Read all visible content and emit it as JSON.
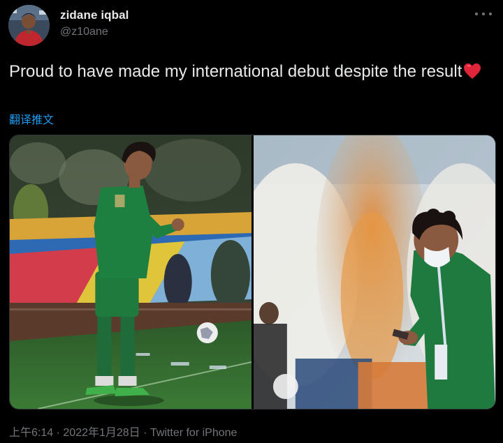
{
  "user": {
    "display_name": "zidane iqbal",
    "handle": "@z10ane"
  },
  "tweet": {
    "text": "Proud to have made my international debut despite the result",
    "emoji": "heart-emoji",
    "translate_label": "翻译推文"
  },
  "media": {
    "photos": [
      {
        "description": "player-green-kit-on-pitch"
      },
      {
        "description": "player-masked-looking-at-phone"
      }
    ]
  },
  "meta": {
    "time": "上午6:14",
    "separator": "·",
    "date": "2022年1月28日",
    "source": "Twitter for iPhone"
  },
  "colors": {
    "background": "#000000",
    "text_primary": "#e7e9ea",
    "text_secondary": "#71767b",
    "link": "#1d9bf0",
    "heart": "#f91880"
  }
}
